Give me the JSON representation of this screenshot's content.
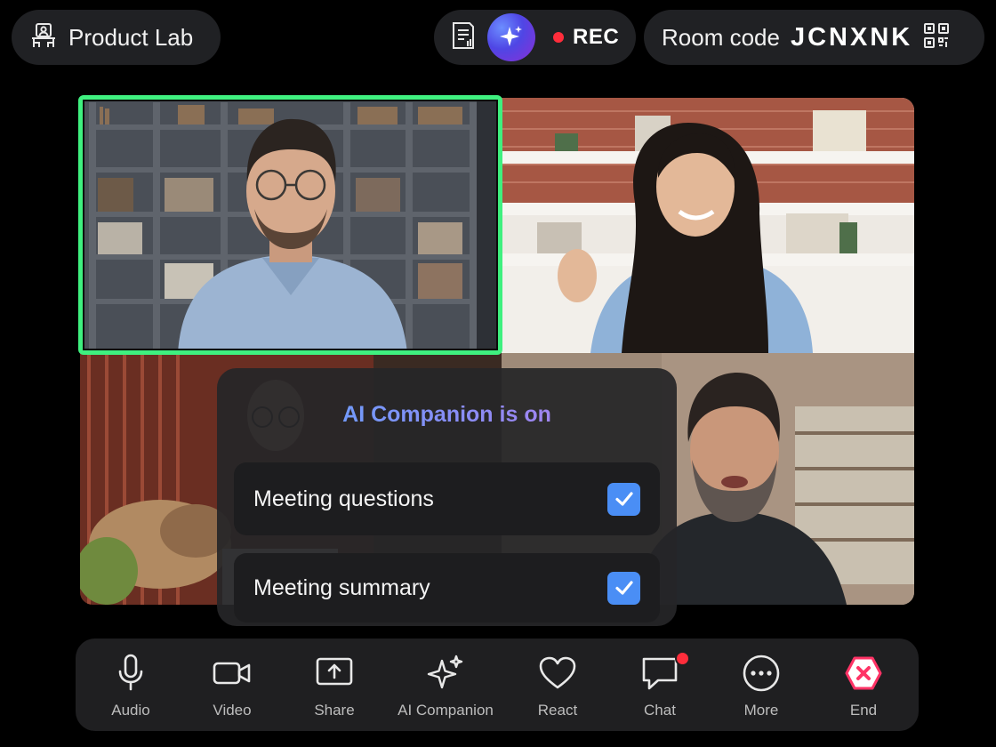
{
  "header": {
    "room_name": "Product Lab",
    "recording_label": "REC",
    "room_code_label": "Room code",
    "room_code": "JCNXNK"
  },
  "ai_companion": {
    "title": "AI Companion is on",
    "options": [
      {
        "label": "Meeting questions",
        "checked": true
      },
      {
        "label": "Meeting summary",
        "checked": true
      }
    ]
  },
  "toolbar": {
    "items": [
      {
        "label": "Audio",
        "icon": "microphone-icon"
      },
      {
        "label": "Video",
        "icon": "video-camera-icon"
      },
      {
        "label": "Share",
        "icon": "share-screen-icon"
      },
      {
        "label": "AI Companion",
        "icon": "sparkle-icon"
      },
      {
        "label": "React",
        "icon": "heart-icon"
      },
      {
        "label": "Chat",
        "icon": "chat-bubble-icon"
      },
      {
        "label": "More",
        "icon": "more-icon"
      },
      {
        "label": "End",
        "icon": "end-call-icon"
      }
    ]
  },
  "colors": {
    "active_speaker_border": "#3ff07f",
    "rec_dot": "#ff2d3b",
    "checkbox": "#4a8ef5",
    "end_icon": "#ff3366"
  }
}
